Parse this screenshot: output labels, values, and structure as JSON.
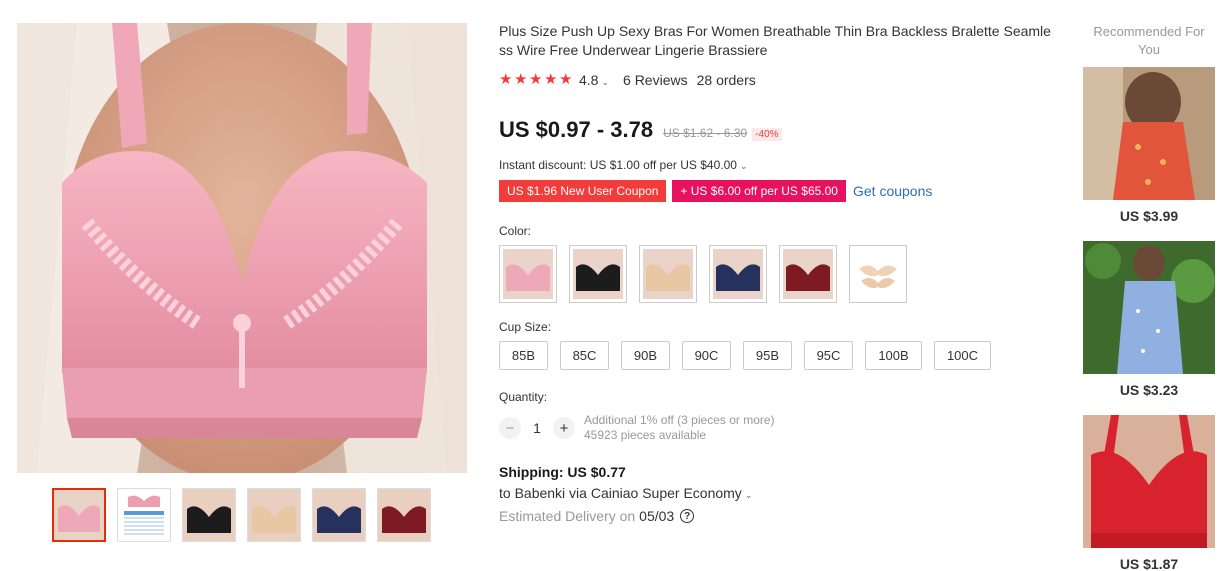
{
  "product": {
    "title": "Plus Size Push Up Sexy Bras For Women Breathable Thin Bra Backless Bralette Seamless Wire Free Underwear Lingerie Brassiere",
    "rating": "4.8",
    "reviews": "6 Reviews",
    "orders": "28 orders",
    "price": "US $0.97 - 3.78",
    "original_price": "US $1.62 - 6.30",
    "discount_pct": "-40%",
    "instant_discount": "Instant discount: US $1.00 off per US $40.00",
    "coupons": [
      "US $1.96 New User Coupon",
      "US $6.00 off per US $65.00"
    ],
    "get_coupons": "Get coupons"
  },
  "color": {
    "label": "Color:",
    "options": [
      {
        "name": "pink",
        "hex": "#eea9b8"
      },
      {
        "name": "black",
        "hex": "#1c1c1c"
      },
      {
        "name": "beige",
        "hex": "#e8c7a5"
      },
      {
        "name": "navy",
        "hex": "#27315e"
      },
      {
        "name": "wine",
        "hex": "#7d1a23"
      },
      {
        "name": "nipple-cover",
        "hex": "#f0d2b4"
      }
    ]
  },
  "cup_size": {
    "label": "Cup Size:",
    "options": [
      "85B",
      "85C",
      "90B",
      "90C",
      "95B",
      "95C",
      "100B",
      "100C"
    ]
  },
  "quantity": {
    "label": "Quantity:",
    "value": "1",
    "note1": "Additional 1% off (3 pieces or more)",
    "note2": "45923 pieces available"
  },
  "shipping": {
    "title": "Shipping: US $0.77",
    "method": "to Babenki via Cainiao Super Economy",
    "delivery_label": "Estimated Delivery on",
    "delivery_date": "05/03"
  },
  "recommended": {
    "title": "Recommended For You",
    "items": [
      {
        "price": "US $3.99"
      },
      {
        "price": "US $3.23"
      },
      {
        "price": "US $1.87"
      }
    ]
  },
  "colors": {
    "accent": "#f23b3b",
    "coupon_magenta": "#e8115e",
    "link": "#2e6eb5"
  }
}
